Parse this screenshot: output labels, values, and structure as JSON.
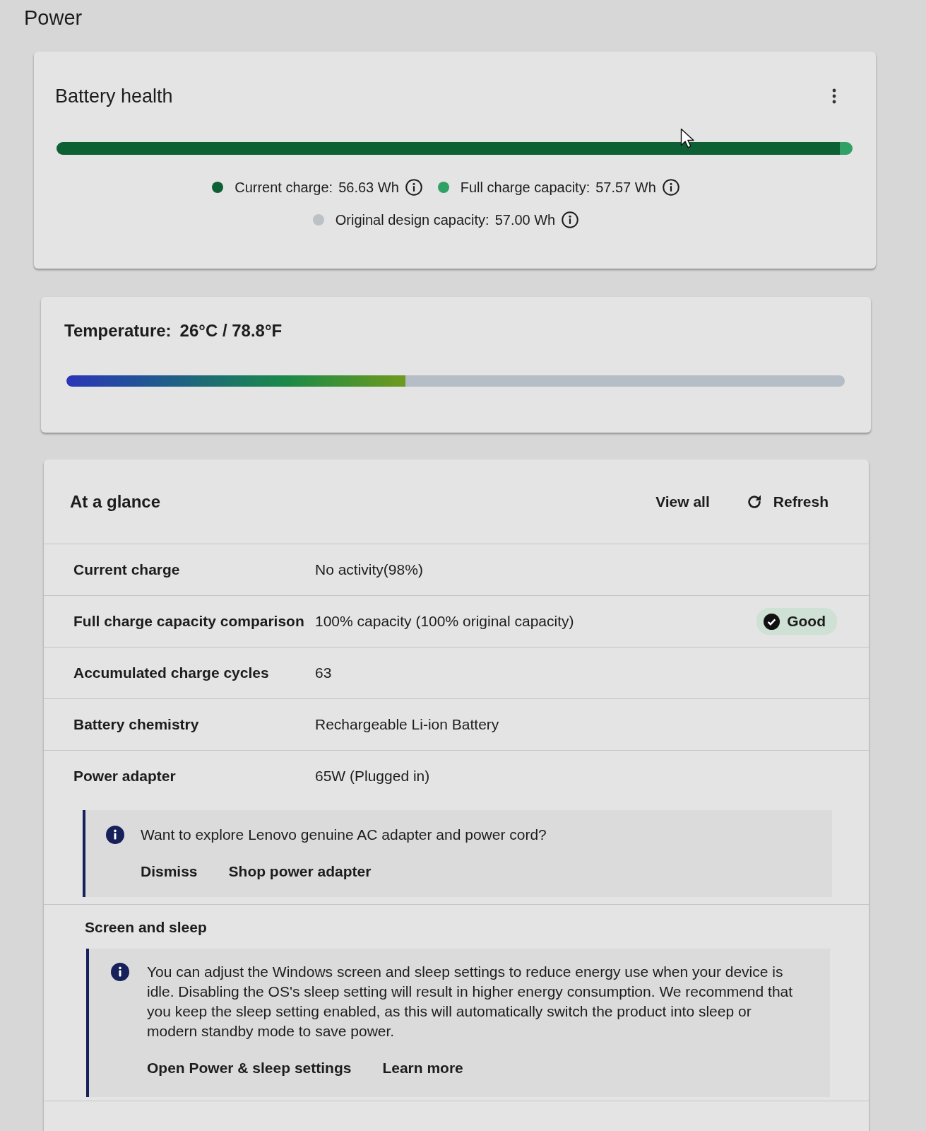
{
  "page": {
    "title": "Power"
  },
  "battery_health": {
    "title": "Battery health",
    "bar": [
      {
        "level": 0.984,
        "color": "#0d5f34"
      },
      {
        "level": 1,
        "color": "#31a065"
      }
    ],
    "legend_rows": [
      [
        {
          "label": "Current charge:",
          "value": "56.63 Wh",
          "color": "#0d5f34"
        },
        {
          "label": "Full charge capacity:",
          "value": "57.57 Wh",
          "color": "#31a065"
        }
      ],
      [
        {
          "label": "Original design capacity:",
          "value": "57.00 Wh",
          "color": "#bcc1c6"
        }
      ]
    ]
  },
  "temperature": {
    "label": "Temperature:",
    "value": "26°C / 78.8°F",
    "level": 0.436
  },
  "at_a_glance": {
    "title": "At a glance",
    "actions": [
      {
        "kind": "link",
        "label": "View all"
      },
      {
        "kind": "refresh",
        "label": "Refresh"
      }
    ],
    "rows": [
      {
        "label": "Current charge",
        "value": "No activity(98%)"
      },
      {
        "label": "Full charge capacity comparison",
        "value": "100% capacity (100% original capacity)",
        "status": "Good"
      },
      {
        "label": "Accumulated charge cycles",
        "value": "63"
      },
      {
        "label": "Battery chemistry",
        "value": "Rechargeable Li-ion Battery"
      },
      {
        "label": "Power adapter",
        "value": "65W (Plugged in)",
        "notice": {
          "text": "Want to explore Lenovo genuine AC adapter and power cord?",
          "actions": [
            "Dismiss",
            "Shop power adapter"
          ]
        }
      }
    ],
    "sections": [
      {
        "title": "Screen and sleep",
        "notice": {
          "text": "You can adjust the Windows screen and sleep settings to reduce energy use when your device is idle. Disabling the OS's sleep setting will result in higher energy consumption. We recommend that you keep the sleep setting enabled, as this will automatically switch the product into sleep or modern standby mode to save power.",
          "actions": [
            "Open Power & sleep settings",
            "Learn more"
          ]
        }
      }
    ]
  }
}
